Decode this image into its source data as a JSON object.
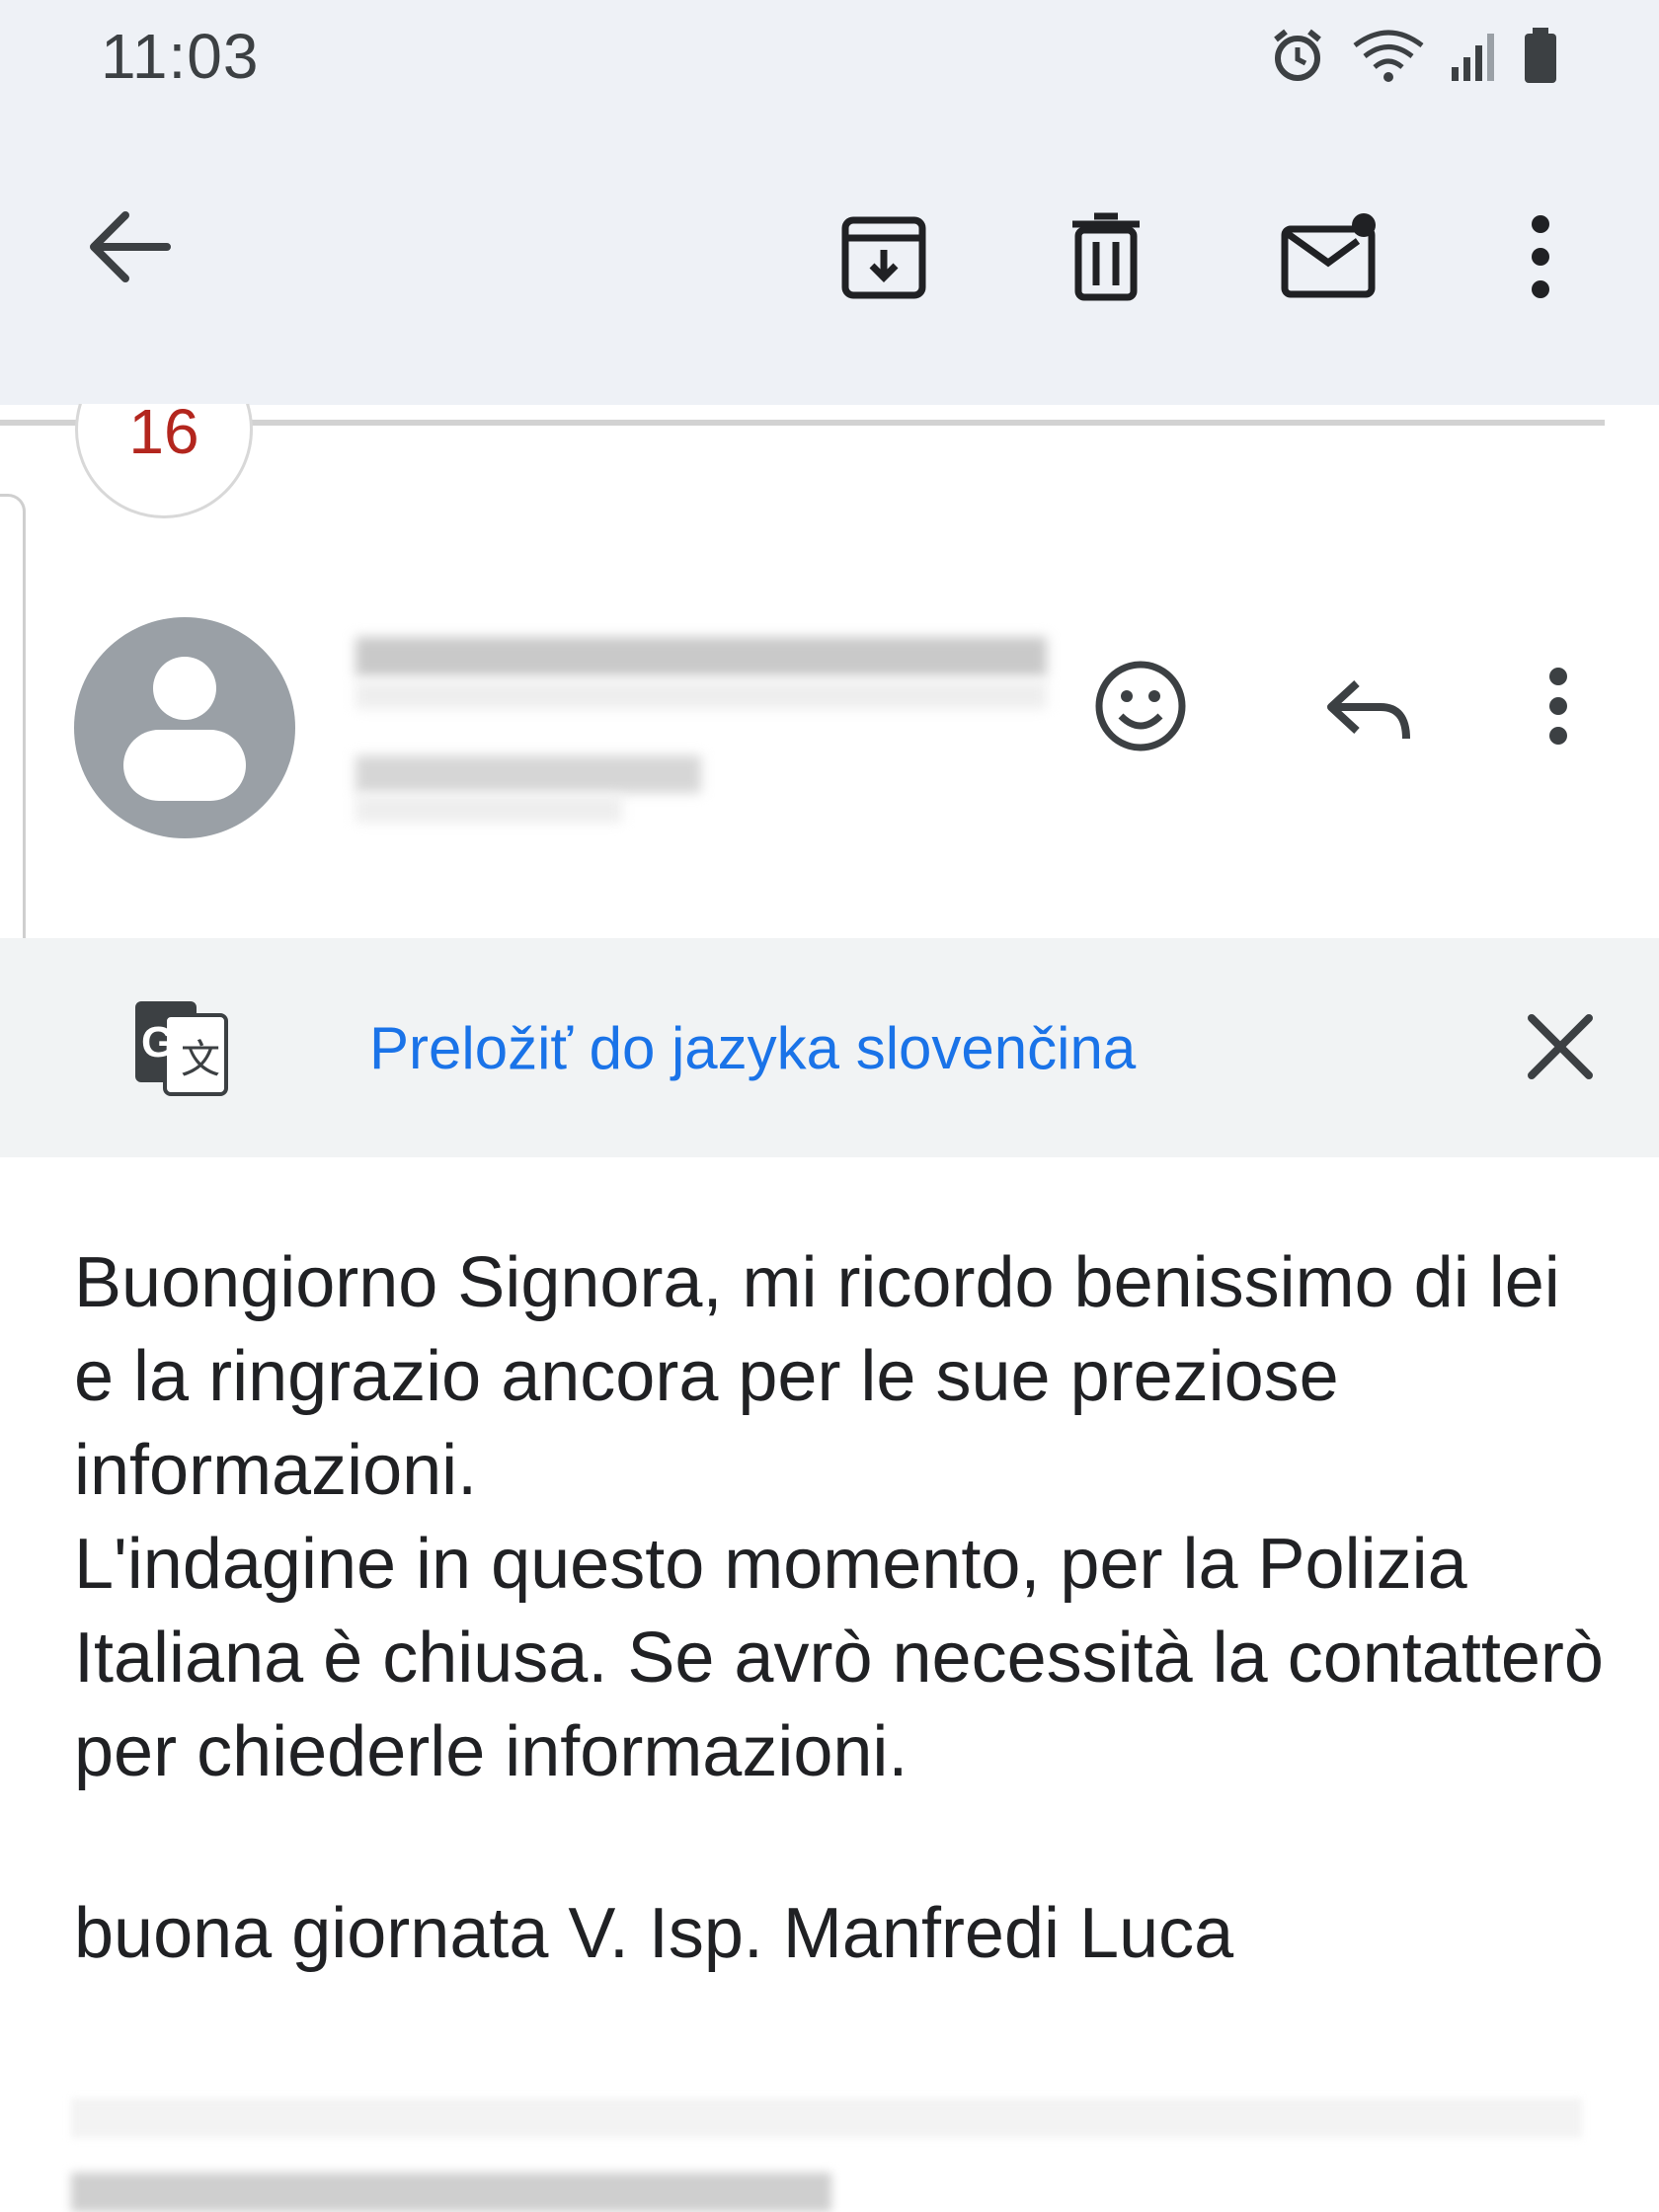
{
  "status_bar": {
    "time": "11:03",
    "icons": [
      "alarm-icon",
      "wifi-icon",
      "signal-icon",
      "battery-icon"
    ]
  },
  "toolbar": {
    "icons": [
      "back-arrow-icon",
      "archive-icon",
      "trash-icon",
      "mark-unread-icon",
      "more-vert-icon"
    ]
  },
  "thread": {
    "hidden_count": "16"
  },
  "sender": {
    "avatar_icon": "person-icon",
    "actions": [
      "emoji-react-icon",
      "reply-icon",
      "more-vert-icon"
    ]
  },
  "translate_banner": {
    "icon": "google-translate-icon",
    "label": "Preložiť do jazyka slovenčina",
    "close_icon": "close-icon"
  },
  "message": {
    "body": [
      "Buongiorno Signora, mi ricordo benissimo di lei e la ringrazio ancora per le sue preziose informazioni.",
      "L'indagine in questo momento, per la Polizia Italiana è chiusa. Se avrò necessità la contatterò per chiederle informazioni."
    ],
    "signature": "buona giornata V. Isp. Manfredi Luca"
  },
  "colors": {
    "appbar_bg": "#eef1f6",
    "link": "#1a73e8",
    "badge_text": "#b3261e"
  }
}
